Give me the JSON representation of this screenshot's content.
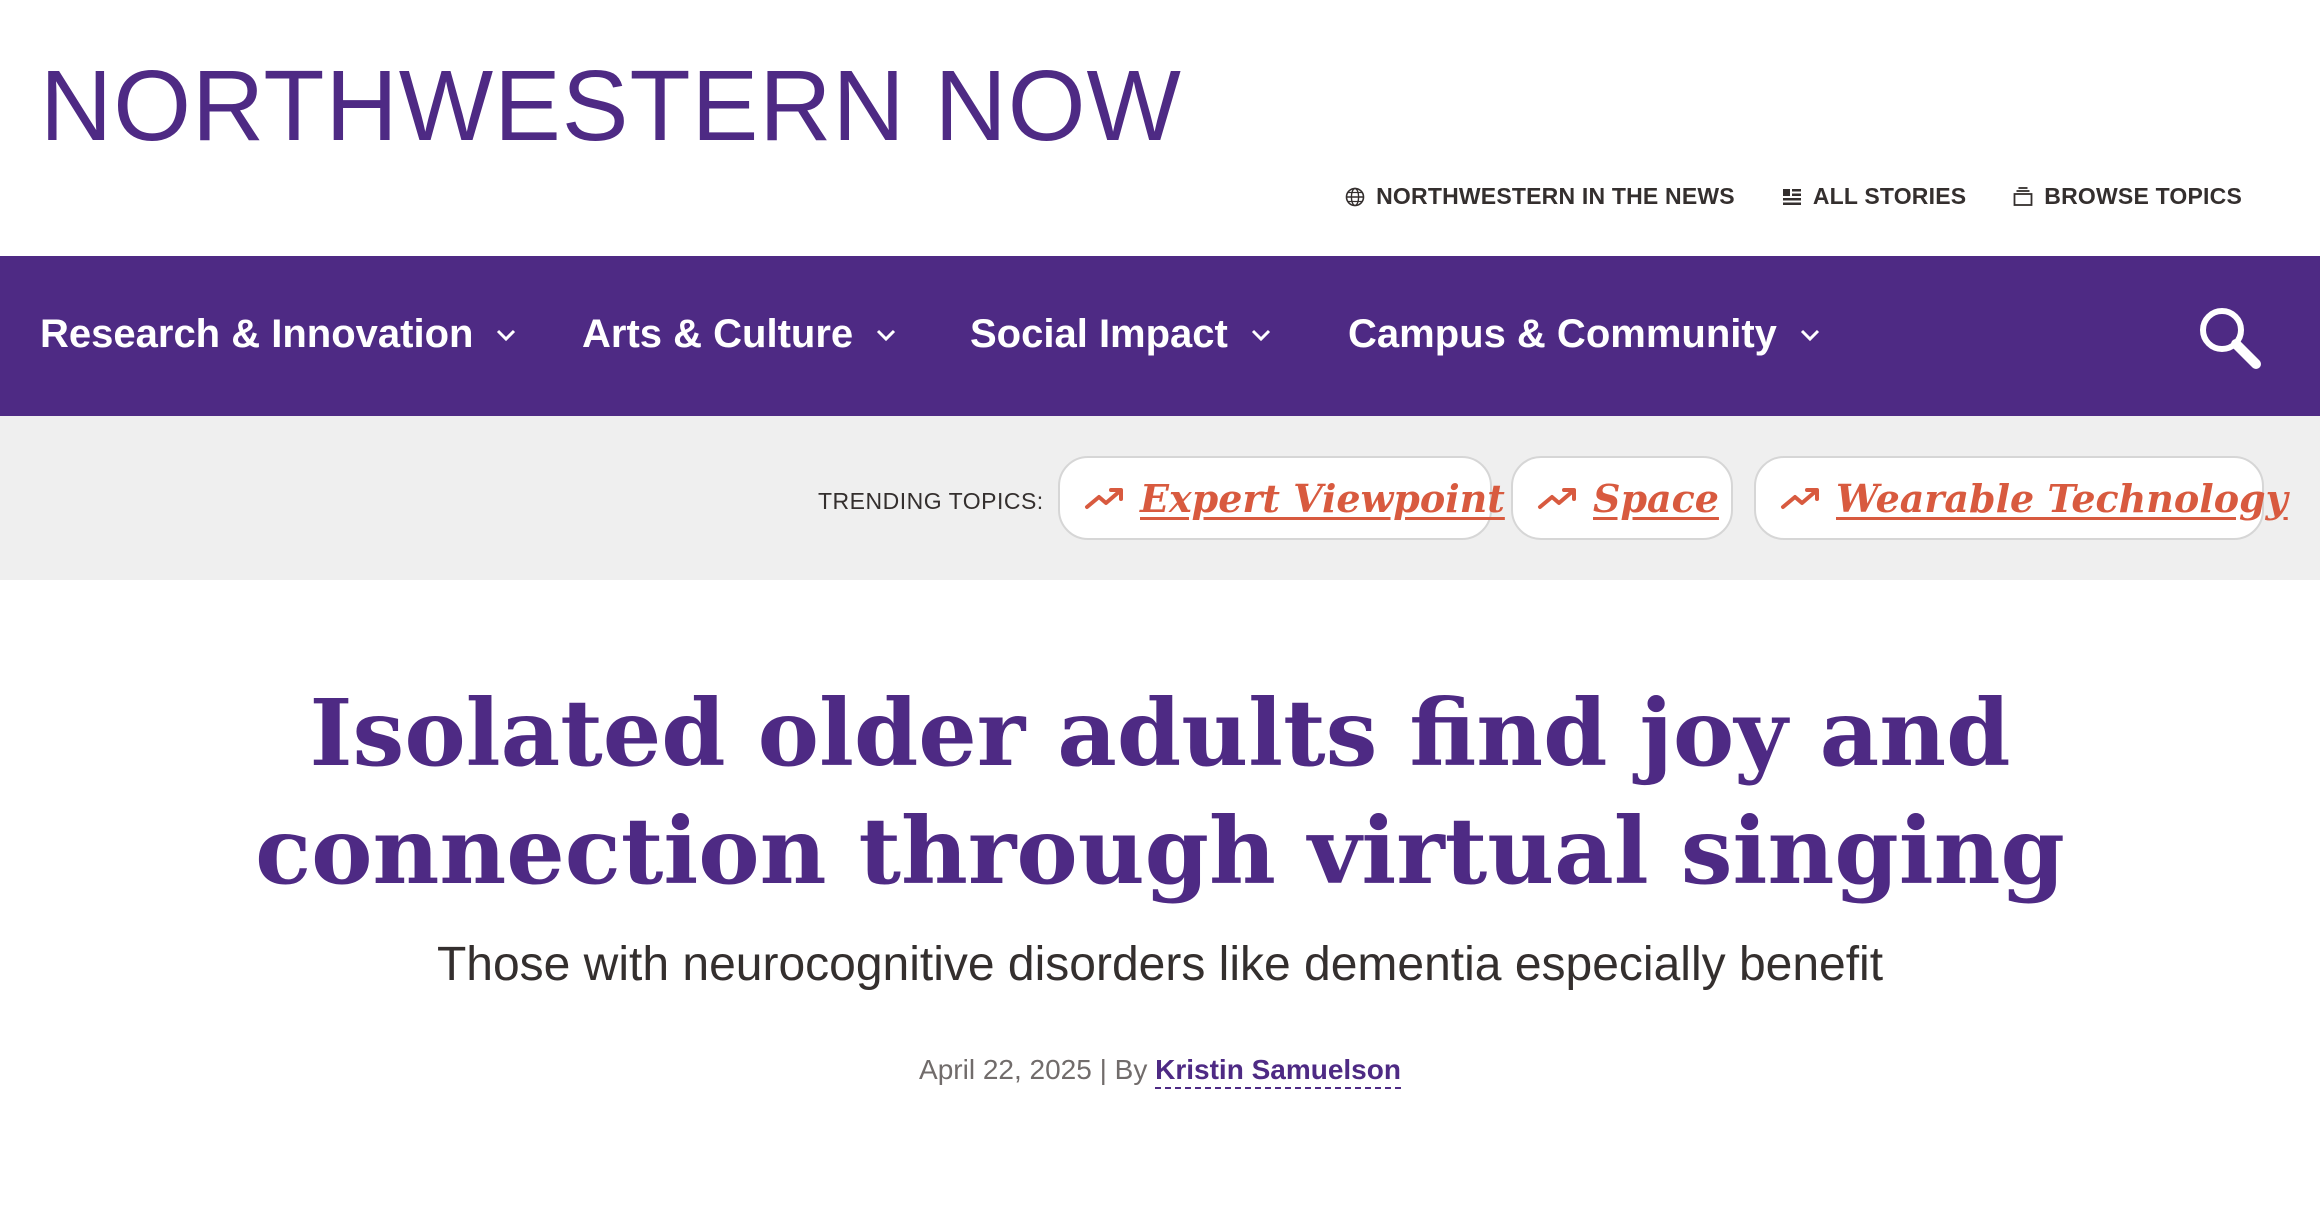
{
  "header": {
    "site_title": "NORTHWESTERN NOW",
    "utility_links": [
      {
        "label": "NORTHWESTERN IN THE NEWS",
        "icon": "globe-icon"
      },
      {
        "label": "ALL STORIES",
        "icon": "list-icon"
      },
      {
        "label": "BROWSE TOPICS",
        "icon": "stack-icon"
      }
    ]
  },
  "nav": {
    "items": [
      {
        "label": "Research & Innovation"
      },
      {
        "label": "Arts & Culture"
      },
      {
        "label": "Social Impact"
      },
      {
        "label": "Campus & Community"
      }
    ],
    "search_icon": "search-icon"
  },
  "trending": {
    "label": "TRENDING TOPICS:",
    "topics": [
      {
        "label": "Expert Viewpoint"
      },
      {
        "label": "Space"
      },
      {
        "label": "Wearable Technology"
      }
    ]
  },
  "article": {
    "headline_line1": "Isolated older adults find joy and",
    "headline_line2": "connection through virtual singing",
    "subhead": "Those with neurocognitive disorders like dementia especially benefit",
    "date": "April 22, 2025",
    "by_separator": " | By ",
    "author": "Kristin Samuelson"
  },
  "colors": {
    "brand_purple": "#4e2a84",
    "trending_accent": "#d85a3f",
    "trending_bg": "#efefef"
  }
}
